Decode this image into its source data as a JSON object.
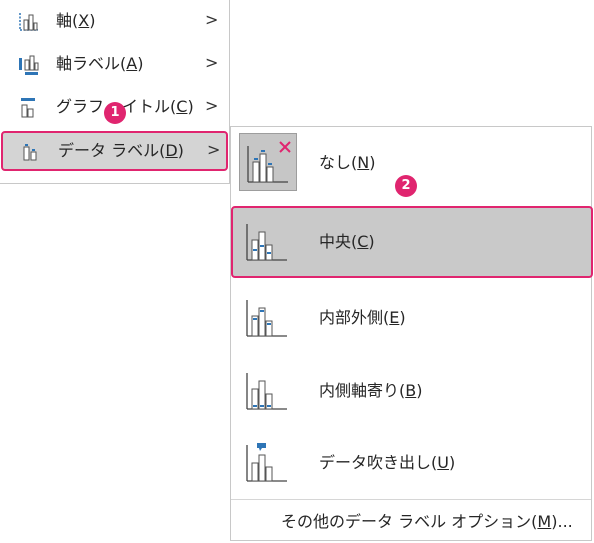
{
  "menu1": {
    "items": [
      {
        "pre": "軸(",
        "key": "X",
        "post": ")",
        "arrow": ">"
      },
      {
        "pre": "軸ラベル(",
        "key": "A",
        "post": ")",
        "arrow": ">"
      },
      {
        "pre": "グラフ",
        "mid": "イトル(",
        "key": "C",
        "post": ")",
        "arrow": ">"
      },
      {
        "pre": "データ ラベル(",
        "key": "D",
        "post": ")",
        "arrow": ">"
      }
    ]
  },
  "menu2": {
    "items": [
      {
        "pre": "なし(",
        "key": "N",
        "post": ")"
      },
      {
        "pre": "中央(",
        "key": "C",
        "post": ")"
      },
      {
        "pre": "内部外側(",
        "key": "E",
        "post": ")"
      },
      {
        "pre": "内側軸寄り(",
        "key": "B",
        "post": ")"
      },
      {
        "pre": "データ吹き出し(",
        "key": "U",
        "post": ")"
      }
    ],
    "more": {
      "pre": "その他のデータ ラベル オプション(",
      "key": "M",
      "post": ")..."
    }
  },
  "badges": {
    "one": "1",
    "two": "2"
  },
  "colors": {
    "accent": "#e0256f",
    "icon_blue": "#2e75b6",
    "highlight": "#c9c9c9"
  },
  "icons": [
    "axis-icon",
    "axis-label-icon",
    "chart-title-icon",
    "data-label-icon",
    "data-label-none-icon",
    "data-label-center-icon",
    "data-label-inside-end-icon",
    "data-label-inside-base-icon",
    "data-callout-icon"
  ]
}
